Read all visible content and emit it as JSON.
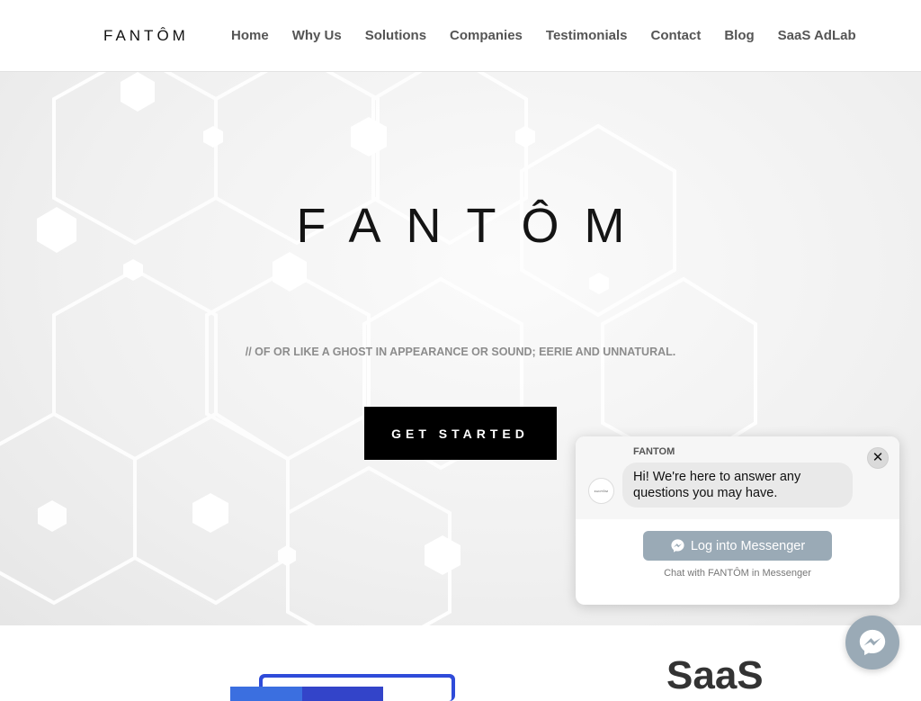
{
  "header": {
    "logo_text": "FANTÔM",
    "nav": [
      "Home",
      "Why Us",
      "Solutions",
      "Companies",
      "Testimonials",
      "Contact",
      "Blog",
      "SaaS AdLab"
    ]
  },
  "hero": {
    "title": "FANTÔM",
    "tagline": "// OF OR LIKE A GHOST IN APPEARANCE OR SOUND; EERIE AND UNNATURAL.",
    "cta_label": "GET STARTED"
  },
  "section2": {
    "heading": "SaaS"
  },
  "chat": {
    "sender": "FANTOM",
    "avatar_text": "FANTÔM",
    "message": "Hi! We're here to answer any questions you may have.",
    "close_glyph": "✕",
    "login_label": "Log into Messenger",
    "footer": "Chat with FANTÔM in Messenger"
  },
  "colors": {
    "accent": "#000000",
    "messenger": "#9aaab6"
  },
  "icons": {
    "close": "close-icon",
    "messenger": "messenger-icon"
  }
}
